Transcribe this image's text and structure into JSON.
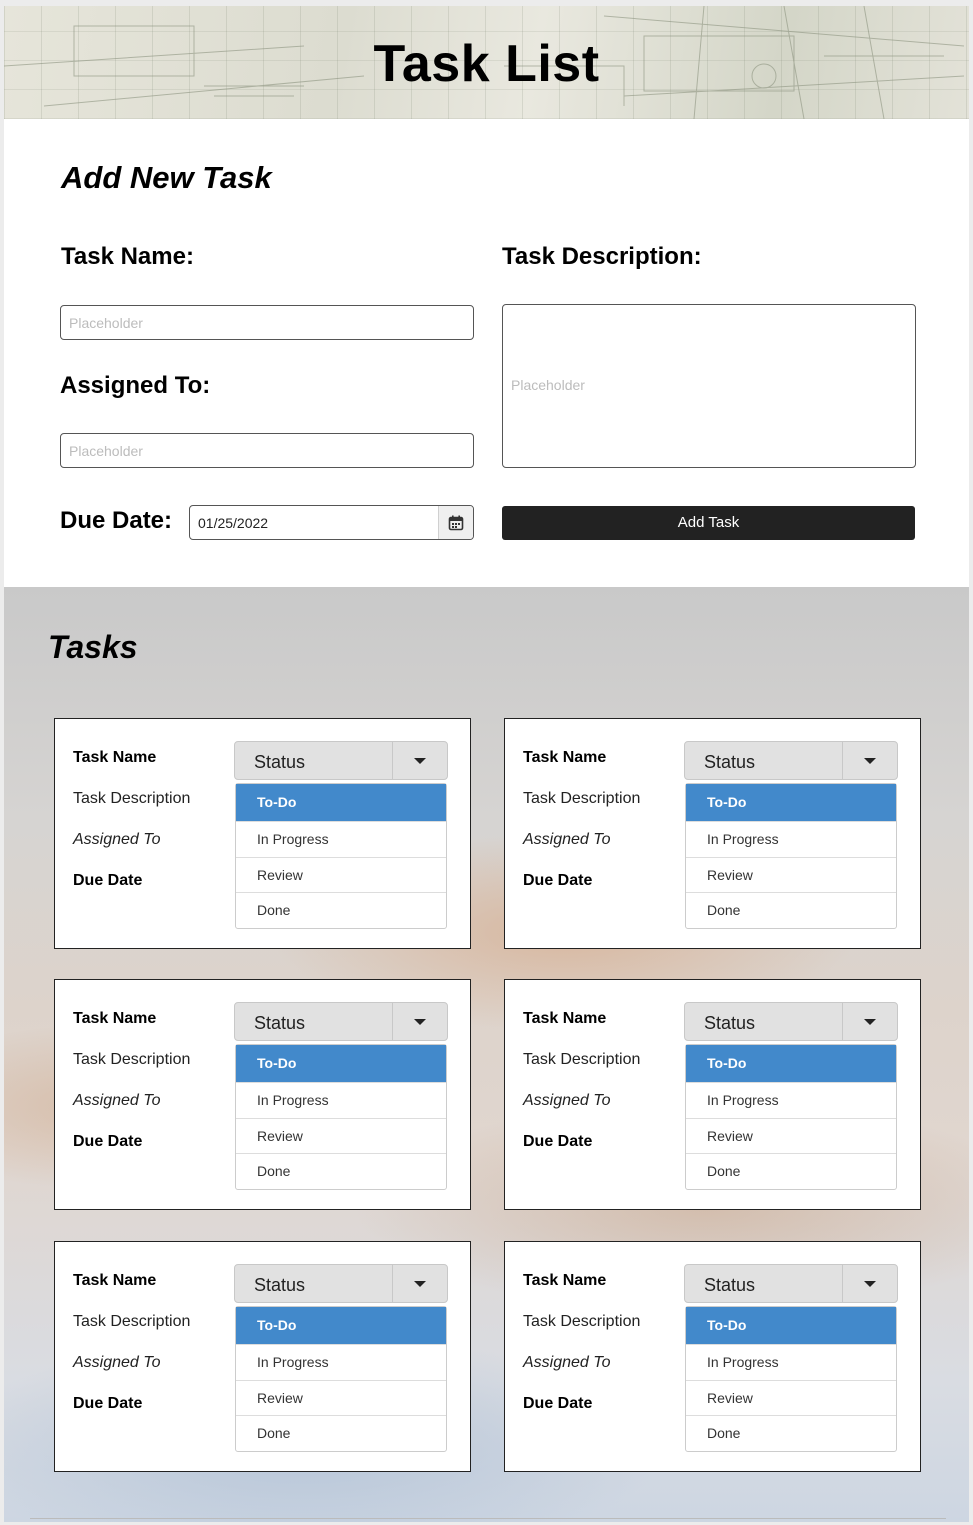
{
  "header": {
    "title": "Task List"
  },
  "form": {
    "title": "Add New Task",
    "task_name_label": "Task Name:",
    "task_name_placeholder": "Placeholder",
    "assigned_label": "Assigned To:",
    "assigned_placeholder": "Placeholder",
    "description_label": "Task Description:",
    "description_placeholder": "Placeholder",
    "due_label": "Due Date:",
    "due_value": "01/25/2022",
    "add_button": "Add Task"
  },
  "tasks": {
    "title": "Tasks",
    "cards": [
      {
        "name": "Task Name",
        "description": "Task Description",
        "assigned": "Assigned To",
        "due": "Due Date",
        "status": "Status",
        "options": [
          "To-Do",
          "In Progress",
          "Review",
          "Done"
        ]
      },
      {
        "name": "Task Name",
        "description": "Task Description",
        "assigned": "Assigned To",
        "due": "Due Date",
        "status": "Status",
        "options": [
          "To-Do",
          "In Progress",
          "Review",
          "Done"
        ]
      },
      {
        "name": "Task Name",
        "description": "Task Description",
        "assigned": "Assigned To",
        "due": "Due Date",
        "status": "Status",
        "options": [
          "To-Do",
          "In Progress",
          "Review",
          "Done"
        ]
      },
      {
        "name": "Task Name",
        "description": "Task Description",
        "assigned": "Assigned To",
        "due": "Due Date",
        "status": "Status",
        "options": [
          "To-Do",
          "In Progress",
          "Review",
          "Done"
        ]
      },
      {
        "name": "Task Name",
        "description": "Task Description",
        "assigned": "Assigned To",
        "due": "Due Date",
        "status": "Status",
        "options": [
          "To-Do",
          "In Progress",
          "Review",
          "Done"
        ]
      },
      {
        "name": "Task Name",
        "description": "Task Description",
        "assigned": "Assigned To",
        "due": "Due Date",
        "status": "Status",
        "options": [
          "To-Do",
          "In Progress",
          "Review",
          "Done"
        ]
      }
    ]
  },
  "colors": {
    "accent": "#4289cb",
    "button": "#222222"
  },
  "icons": {
    "date_picker": "calendar-icon",
    "dropdown": "caret-down-icon"
  }
}
